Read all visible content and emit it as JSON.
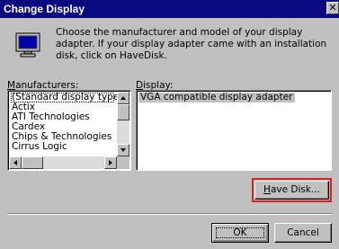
{
  "window": {
    "title": "Change Display",
    "close_glyph": "✕"
  },
  "intro": {
    "text": "Choose the manufacturer and model of your display adapter.  If your display adapter came with an installation disk, click on HaveDisk."
  },
  "icons": {
    "dialog": "monitor-icon"
  },
  "manufacturers": {
    "label_first": "M",
    "label_rest": "anufacturers:",
    "items": [
      "(Standard display types)",
      "Actix",
      "ATI Technologies",
      "Cardex",
      "Chips & Technologies",
      "Cirrus Logic"
    ],
    "selected_index": 0
  },
  "display": {
    "label_first": "D",
    "label_rest": "isplay:",
    "items": [
      "VGA compatible display adapter"
    ],
    "selected_index": 0
  },
  "buttons": {
    "have_disk_first": "H",
    "have_disk_rest": "ave Disk...",
    "ok": "OK",
    "cancel": "Cancel"
  },
  "colors": {
    "titlebar": "#0a0a80",
    "highlight": "#e02020",
    "face": "#c0c0c0"
  }
}
